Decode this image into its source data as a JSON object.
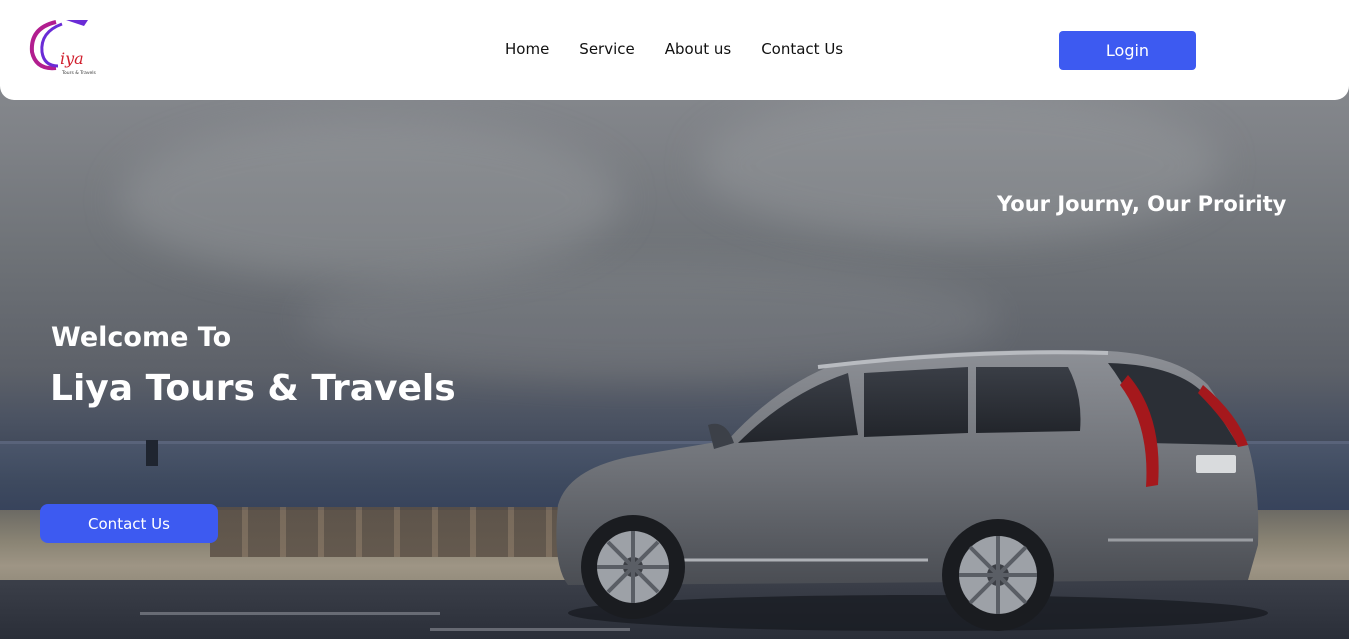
{
  "colors": {
    "accent": "#3d5af1",
    "navbar_bg": "#ffffff",
    "hero_text": "#ffffff"
  },
  "header": {
    "logo_text": "Liya",
    "logo_subtext": "Tours & Travels",
    "nav": [
      {
        "label": "Home"
      },
      {
        "label": "Service"
      },
      {
        "label": "About us"
      },
      {
        "label": "Contact Us"
      }
    ],
    "login_label": "Login"
  },
  "hero": {
    "tagline": "Your Journy, Our Proirity",
    "welcome": "Welcome To",
    "brand": "Liya Tours & Travels",
    "contact_label": "Contact Us",
    "background_icon": "suv-on-beach-image"
  }
}
